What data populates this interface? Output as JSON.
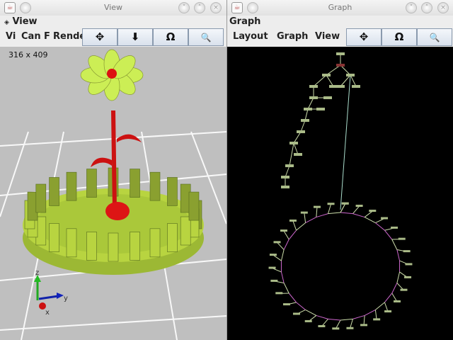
{
  "view_window": {
    "title": "View",
    "menu_title": "View",
    "menus": [
      "Vi",
      "Can",
      "F",
      "Rende"
    ],
    "dims": "316 x 409",
    "buttons": [
      {
        "icon": "move-icon",
        "glyph": "✥"
      },
      {
        "icon": "down-arrow-icon",
        "glyph": "⬇"
      },
      {
        "icon": "rotate-icon",
        "glyph": "Ω"
      },
      {
        "icon": "zoom-icon",
        "glyph": "🔍"
      }
    ],
    "axes": {
      "x": "x",
      "y": "y",
      "z": "z"
    }
  },
  "graph_window": {
    "title": "Graph",
    "menu_title": "Graph",
    "menus": [
      "Layout",
      "Graph",
      "View"
    ],
    "buttons": [
      {
        "icon": "move-icon",
        "glyph": "✥"
      },
      {
        "icon": "rotate-icon",
        "glyph": "Ω"
      },
      {
        "icon": "zoom-icon",
        "glyph": "🔍"
      }
    ]
  },
  "colors": {
    "flower": "#ccee55",
    "stem": "#dd1111",
    "edge": "#ccddaa",
    "node": "#aabb88"
  }
}
